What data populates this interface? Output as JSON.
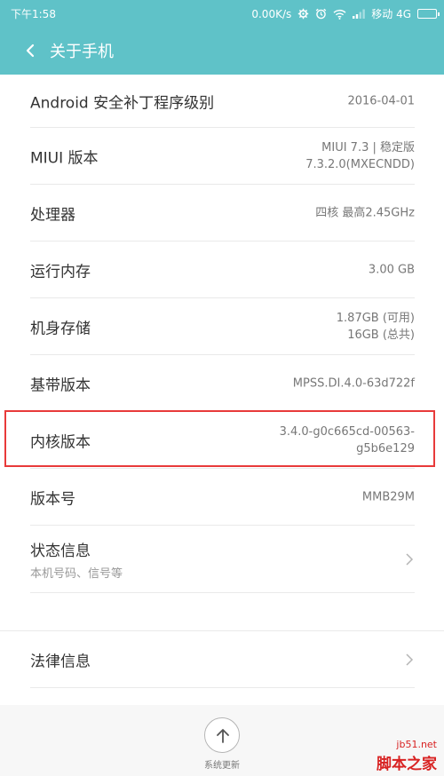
{
  "status_bar": {
    "time": "下午1:58",
    "speed": "0.00K/s",
    "carrier": "移动 4G"
  },
  "header": {
    "title": "关于手机"
  },
  "rows": [
    {
      "label": "Android 安全补丁程序级别",
      "value_lines": [
        "2016-04-01"
      ]
    },
    {
      "label": "MIUI 版本",
      "value_lines": [
        "MIUI 7.3 | 稳定版",
        "7.3.2.0(MXECNDD)"
      ]
    },
    {
      "label": "处理器",
      "value_lines": [
        "四核 最高2.45GHz"
      ]
    },
    {
      "label": "运行内存",
      "value_lines": [
        "3.00 GB"
      ]
    },
    {
      "label": "机身存储",
      "value_lines": [
        "1.87GB (可用)",
        "16GB (总共)"
      ]
    },
    {
      "label": "基带版本",
      "value_lines": [
        "MPSS.DI.4.0-63d722f"
      ]
    },
    {
      "label": "内核版本",
      "value_lines": [
        "3.4.0-g0c665cd-00563-",
        "g5b6e129"
      ]
    },
    {
      "label": "版本号",
      "value_lines": [
        "MMB29M"
      ]
    },
    {
      "label": "状态信息",
      "sublabel": "本机号码、信号等"
    },
    {
      "label": "法律信息"
    }
  ],
  "bottom": {
    "update_label": "系统更新"
  },
  "watermark": {
    "site": "jb51.net",
    "name": "脚本之家"
  },
  "colors": {
    "header": "#5fc2c8",
    "highlight": "#e83a3a"
  }
}
